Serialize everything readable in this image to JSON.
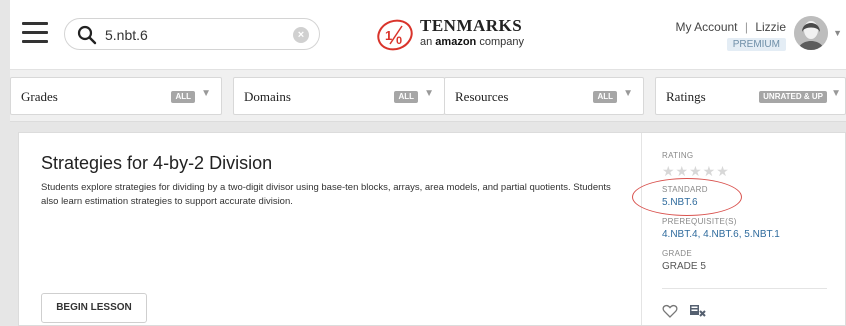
{
  "header": {
    "search": {
      "value": "5.nbt.6",
      "clear_icon": "×"
    },
    "logo": {
      "title": "TENMARKS",
      "sub_prefix": "an ",
      "sub_brand": "amazon",
      "sub_suffix": " company"
    },
    "account": {
      "my_account": "My Account",
      "separator": "|",
      "user": "Lizzie",
      "badge": "PREMIUM"
    }
  },
  "filters": [
    {
      "label": "Grades",
      "badge": "ALL"
    },
    {
      "label": "Domains",
      "badge": "ALL"
    },
    {
      "label": "Resources",
      "badge": "ALL"
    },
    {
      "label": "Ratings",
      "badge": "UNRATED & UP"
    }
  ],
  "lesson": {
    "title": "Strategies for 4-by-2 Division",
    "description": "Students explore strategies for dividing by a two-digit divisor using base-ten blocks, arrays, area models, and partial quotients. Students also learn estimation strategies to support accurate division.",
    "begin_button": "BEGIN LESSON",
    "rating_label": "RATING",
    "stars": "★★★★★",
    "standard_label": "STANDARD",
    "standard_value": "5.NBT.6",
    "prerequisites_label": "PREREQUISITE(S)",
    "prerequisites_value": "4.NBT.4, 4.NBT.6, 5.NBT.1",
    "grade_label": "GRADE",
    "grade_value": "GRADE 5"
  },
  "colors": {
    "link": "#2f6b9d",
    "highlight": "#d9534f",
    "badge": "#a6a6a6",
    "logo_red": "#d9342b"
  }
}
